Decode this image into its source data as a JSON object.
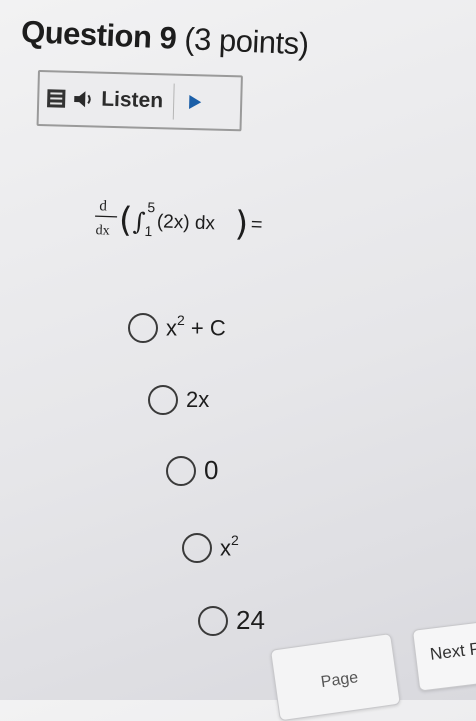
{
  "question": {
    "title": "Question 9",
    "points": "(3 points)"
  },
  "listen": {
    "label": "Listen",
    "menu_icon": "menu-icon",
    "speaker_icon": "speaker-icon",
    "play_icon": "play-icon"
  },
  "equation": {
    "d_top": "d",
    "d_bottom": "dx",
    "upper_limit": "5",
    "lower_limit": "1",
    "integrand": "(2x) dx",
    "equals": "="
  },
  "options": [
    {
      "base": "x",
      "sup": "2",
      "rest": " + C"
    },
    {
      "base": "2x",
      "sup": "",
      "rest": ""
    },
    {
      "base": "0",
      "sup": "",
      "rest": ""
    },
    {
      "base": "x",
      "sup": "2",
      "rest": ""
    },
    {
      "base": "24",
      "sup": "",
      "rest": ""
    }
  ],
  "footer": {
    "page_label": "Page",
    "next_label": "Next Pa"
  }
}
